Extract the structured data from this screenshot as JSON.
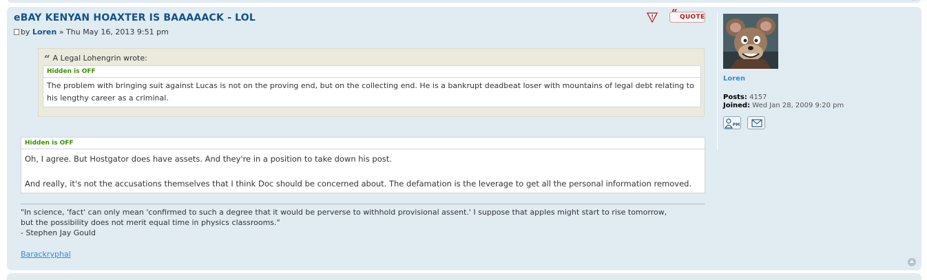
{
  "post": {
    "title": "eBAY KENYAN HOAXTER IS BAAAAACK - LOL",
    "by_prefix": "by",
    "author": "Loren",
    "date_sep": "»",
    "date": "Thu May 16, 2013 9:51 pm",
    "buttons": {
      "report_icon": "report-icon",
      "quote_label": "QUOTE"
    },
    "blockquote": {
      "cite": "A Legal Lohengrin wrote:",
      "hidden_label": "Hidden is OFF",
      "text": "The problem with bringing suit against Lucas is not on the proving end, but on the collecting end. He is a bankrupt deadbeat loser with mountains of legal debt relating to his lengthy career as a criminal."
    },
    "body": {
      "hidden_label": "Hidden is OFF",
      "paragraph1": "Oh, I agree. But Hostgator does have assets. And they're in a position to take down his post.",
      "paragraph2": "And really, it's not the accusations themselves that I think Doc should be concerned about. The defamation is the leverage to get all the personal information removed."
    },
    "signature": {
      "quote_line1": "\"In science, 'fact' can only mean 'confirmed to such a degree that it would be perverse to withhold provisional assent.' I suppose that apples might start to rise tomorrow,",
      "quote_line2": "but the possibility does not merit equal time in physics classrooms.\"",
      "attribution": "- Stephen Jay Gould",
      "link": "Barackryphal"
    }
  },
  "profile": {
    "avatar_icon": "mouse-avatar",
    "name": "Loren",
    "posts_label": "Posts:",
    "posts_value": "4157",
    "joined_label": "Joined:",
    "joined_value": "Wed Jan 28, 2009 9:20 pm",
    "pm_label": "PM",
    "contact_icons": [
      "pm-icon",
      "email-icon"
    ]
  },
  "colors": {
    "post_bg": "#e1ebf2",
    "title": "#105289",
    "link": "#368ad2",
    "hidden_label": "#3a8e00",
    "quote_bg": "#ebeadd"
  }
}
